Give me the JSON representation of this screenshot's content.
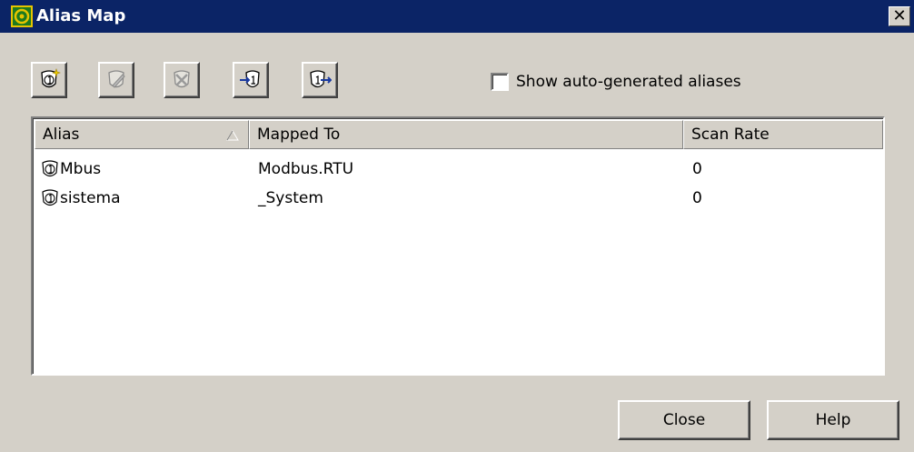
{
  "window": {
    "title": "Alias Map",
    "close_glyph": "✕"
  },
  "toolbar": {
    "buttons": [
      {
        "icon": "new-alias-icon"
      },
      {
        "icon": "edit-alias-icon"
      },
      {
        "icon": "delete-alias-icon"
      },
      {
        "icon": "import-alias-icon"
      },
      {
        "icon": "export-alias-icon"
      }
    ],
    "show_auto_label": "Show auto-generated aliases",
    "show_auto_checked": false
  },
  "table": {
    "columns": [
      "Alias",
      "Mapped To",
      "Scan Rate"
    ],
    "sort_column": "Alias",
    "sort_direction": "ascending",
    "rows": [
      {
        "alias": "Mbus",
        "mapped_to": "Modbus.RTU",
        "scan_rate": "0"
      },
      {
        "alias": "sistema",
        "mapped_to": "_System",
        "scan_rate": "0"
      }
    ]
  },
  "footer": {
    "close_label": "Close",
    "help_label": "Help"
  },
  "colors": {
    "titlebar": "#0b2466",
    "dialog_bg": "#d4d0c8"
  }
}
